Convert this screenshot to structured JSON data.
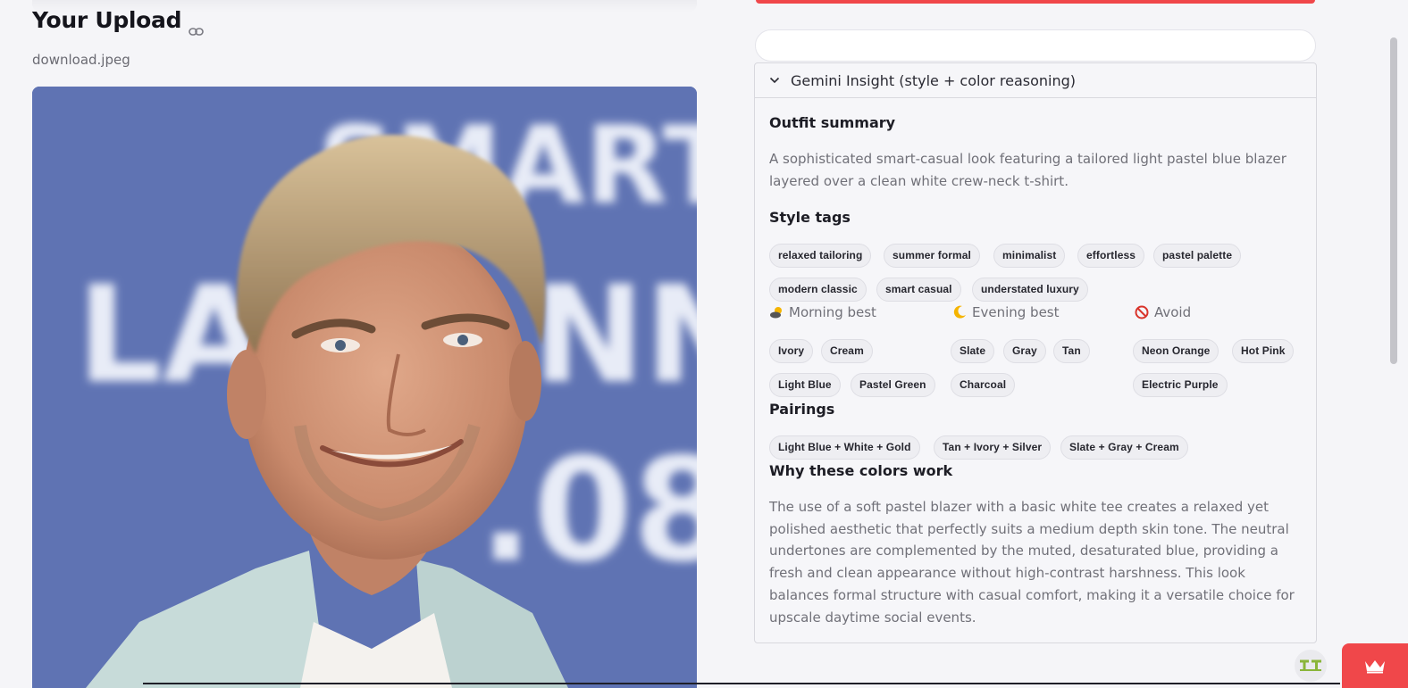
{
  "upload": {
    "title": "Your Upload",
    "file_name": "download.jpeg"
  },
  "insight": {
    "header": "Gemini Insight (style + color reasoning)",
    "outfit_summary_heading": "Outfit summary",
    "outfit_summary": "A sophisticated smart-casual look featuring a tailored light pastel blue blazer layered over a clean white crew-neck t-shirt.",
    "style_tags_heading": "Style tags",
    "style_tags": [
      "relaxed tailoring",
      "summer formal",
      "minimalist",
      "effortless",
      "pastel palette",
      "modern classic",
      "smart casual",
      "understated luxury"
    ],
    "morning_label": "Morning best",
    "evening_label": "Evening best",
    "avoid_label": "Avoid",
    "morning_colors": [
      "Ivory",
      "Cream",
      "Light Blue",
      "Pastel Green"
    ],
    "evening_colors": [
      "Slate",
      "Gray",
      "Tan",
      "Charcoal"
    ],
    "avoid_colors": [
      "Neon Orange",
      "Hot Pink",
      "Electric Purple"
    ],
    "pairings_heading": "Pairings",
    "pairings": [
      "Light Blue + White + Gold",
      "Tan + Ivory + Silver",
      "Slate + Gray + Cream"
    ],
    "why_heading": "Why these colors work",
    "why_text": "The use of a soft pastel blazer with a basic white tee creates a relaxed yet polished aesthetic that perfectly suits a medium depth skin tone. The neutral undertones are complemented by the muted, desaturated blue, providing a fresh and clean appearance without high-contrast harshness. This look balances formal structure with casual comfort, making it a versatile choice for upscale daytime social events."
  },
  "photo_backdrop_text": [
    "SMART",
    "LA",
    "NN",
    ".08"
  ],
  "colors": {
    "accent_red": "#f0474a",
    "backdrop_blue": "#5e72b2"
  },
  "icons": {
    "title_link": "link-icon",
    "collapse": "chevron-down-icon",
    "morning": "sun-behind-cloud-icon",
    "evening": "crescent-moon-icon",
    "avoid": "prohibited-icon",
    "crown": "crown-icon"
  }
}
